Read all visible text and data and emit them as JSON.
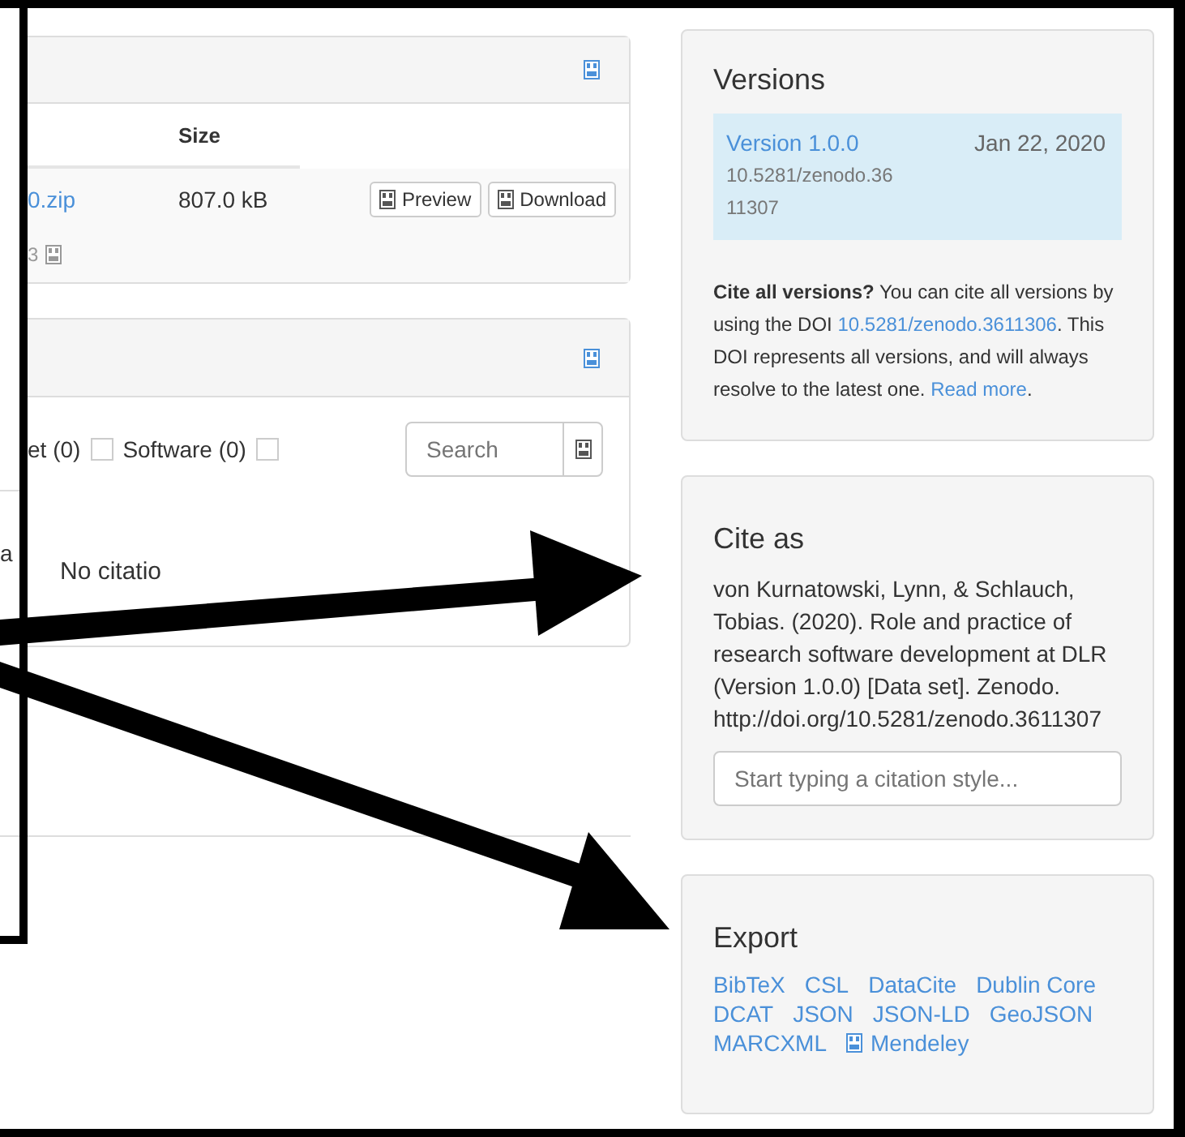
{
  "files": {
    "columns": [
      "Size"
    ],
    "rows": [
      {
        "name": "0.zip",
        "size": "807.0 kB",
        "buttons": [
          "Preview",
          "Download"
        ]
      }
    ],
    "footnote": "3"
  },
  "citations": {
    "filters": [
      {
        "label": "et (0)"
      },
      {
        "label": "Software (0)",
        "checked": false
      },
      {
        "checked": false
      }
    ],
    "search": {
      "placeholder": "Search"
    },
    "side_text": "a",
    "message": "No citatio"
  },
  "versions": {
    "title": "Versions",
    "items": [
      {
        "label": "Version 1.0.0",
        "date": "Jan 22, 2020",
        "doi": "10.5281/zenodo.3611307",
        "selected": true
      }
    ],
    "note": [
      {
        "kind": "text",
        "text": "**Cite all versions?** You can cite all versions by using the DOI "
      },
      {
        "kind": "link",
        "text": "10.5281/zenodo.3611306"
      },
      {
        "kind": "text",
        "text": ". This DOI represents all versions, and will always resolve to the latest one. "
      },
      {
        "kind": "link",
        "text": "Read more"
      },
      {
        "kind": "text",
        "text": "."
      }
    ]
  },
  "cite": {
    "title": "Cite as",
    "text": "von Kurnatowski, Lynn, & Schlauch, Tobias. (2020). Role and practice of research software development at DLR (Version 1.0.0) [Data set]. Zenodo. http://doi.org/10.5281/zenodo.3611307",
    "placeholder": "Start typing a citation style..."
  },
  "export": {
    "title": "Export",
    "links": [
      {
        "label": "BibTeX"
      },
      {
        "label": "CSL"
      },
      {
        "label": "DataCite"
      },
      {
        "label": "Dublin Core"
      },
      {
        "label": "DCAT"
      },
      {
        "label": "JSON"
      },
      {
        "label": "JSON-LD"
      },
      {
        "label": "GeoJSON"
      },
      {
        "label": "MARCXML"
      },
      {
        "label": "Mendeley",
        "icon": true
      }
    ]
  }
}
